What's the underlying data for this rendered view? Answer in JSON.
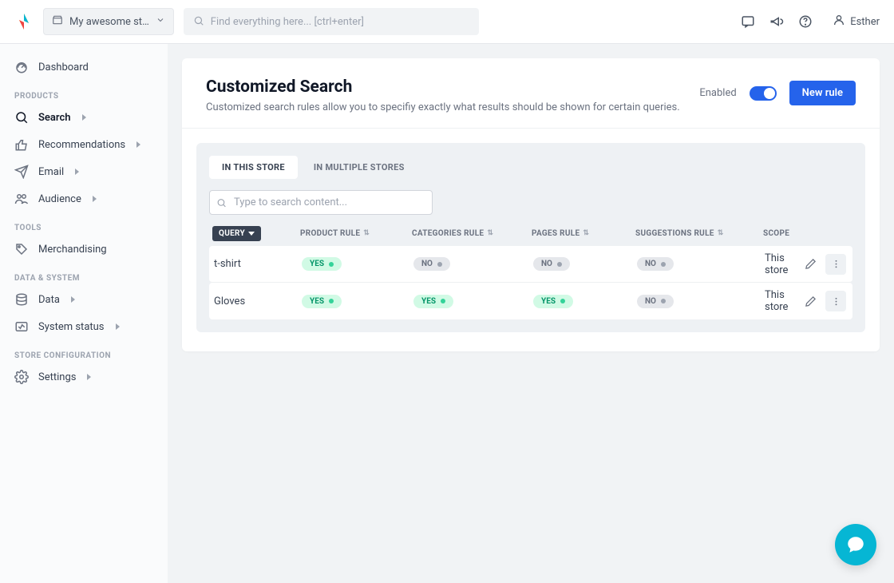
{
  "topbar": {
    "store_name": "My awesome st…",
    "search_placeholder": "Find everything here... [ctrl+enter]",
    "user_name": "Esther"
  },
  "sidebar": {
    "dashboard": "Dashboard",
    "section_products": "PRODUCTS",
    "search": "Search",
    "recommendations": "Recommendations",
    "email": "Email",
    "audience": "Audience",
    "section_tools": "TOOLS",
    "merchandising": "Merchandising",
    "section_data": "DATA & SYSTEM",
    "data": "Data",
    "system_status": "System status",
    "section_store": "STORE CONFIGURATION",
    "settings": "Settings"
  },
  "page": {
    "title": "Customized Search",
    "description": "Customized search rules allow you to specifiy exactly what results should be shown for certain queries.",
    "enabled_label": "Enabled",
    "new_rule_btn": "New rule",
    "tab1": "IN THIS STORE",
    "tab2": "IN MULTIPLE STORES",
    "search_placeholder": "Type to search content...",
    "headers": {
      "query": "QUERY",
      "product_rule": "PRODUCT RULE",
      "categories_rule": "CATEGORIES RULE",
      "pages_rule": "PAGES RULE",
      "suggestions_rule": "SUGGESTIONS RULE",
      "scope": "SCOPE"
    },
    "badges": {
      "yes": "YES",
      "no": "NO"
    },
    "rows": [
      {
        "query": "t-shirt",
        "product": "yes",
        "categories": "no",
        "pages": "no",
        "suggestions": "no",
        "scope": "This store"
      },
      {
        "query": "Gloves",
        "product": "yes",
        "categories": "yes",
        "pages": "yes",
        "suggestions": "no",
        "scope": "This store"
      }
    ]
  }
}
